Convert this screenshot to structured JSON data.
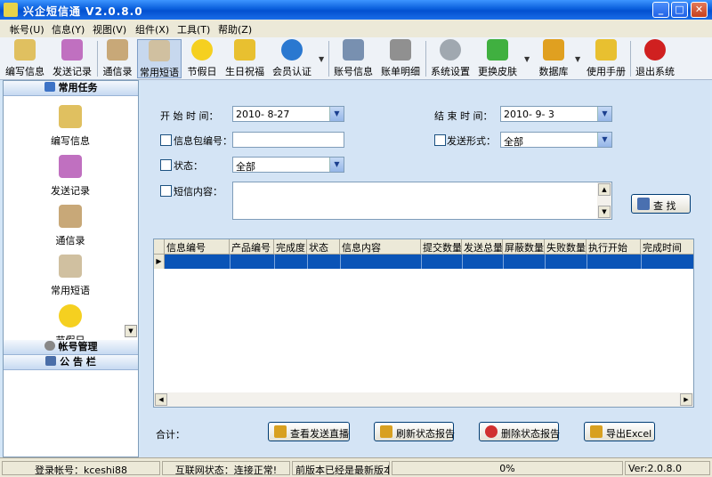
{
  "window": {
    "title": "兴企短信通 V2.0.8.0"
  },
  "menu": [
    "帐号(U)",
    "信息(Y)",
    "视图(V)",
    "组件(X)",
    "工具(T)",
    "帮助(Z)"
  ],
  "toolbar": {
    "items": [
      {
        "label": "编写信息",
        "color": "#e0c060"
      },
      {
        "label": "发送记录",
        "color": "#c070c0"
      },
      {
        "label": "通信录",
        "color": "#c8a878"
      },
      {
        "label": "常用短语",
        "color": "#d0c0a0"
      },
      {
        "label": "节假日",
        "color": "#f5d020"
      },
      {
        "label": "生日祝福",
        "color": "#e8c030"
      },
      {
        "label": "会员认证",
        "color": "#2a78d0"
      },
      {
        "label": "账号信息",
        "color": "#7890b0"
      },
      {
        "label": "账单明细",
        "color": "#909090"
      },
      {
        "label": "系统设置",
        "color": "#a0a8b0"
      },
      {
        "label": "更换皮肤",
        "color": "#40b040"
      },
      {
        "label": "数据库",
        "color": "#e0a020"
      },
      {
        "label": "使用手册",
        "color": "#e8c030"
      },
      {
        "label": "退出系统",
        "color": "#d02020"
      }
    ]
  },
  "sidebar": {
    "section_common": "常用任务",
    "items": [
      {
        "label": "编写信息",
        "color": "#e0c060"
      },
      {
        "label": "发送记录",
        "color": "#c070c0"
      },
      {
        "label": "通信录",
        "color": "#c8a878"
      },
      {
        "label": "常用短语",
        "color": "#d0c0a0"
      },
      {
        "label": "节假日",
        "color": "#f5d020"
      }
    ],
    "section_account": "帐号管理",
    "section_notice": "公 告 栏"
  },
  "form": {
    "start_label": "开 始 时 间：",
    "start_value": "2010- 8-27",
    "end_label": "结 束 时 间：",
    "end_value": "2010- 9- 3",
    "package_label": "信息包编号：",
    "package_value": "",
    "send_mode_label": "发送形式：",
    "send_mode_value": "全部",
    "status_label": "状态：",
    "status_value": "全部",
    "content_label": "短信内容：",
    "content_value": "",
    "search_label": "查 找"
  },
  "grid": {
    "columns": [
      "信息编号",
      "产品编号",
      "完成度",
      "状态",
      "信息内容",
      "提交数量",
      "发送总量",
      "屏蔽数量",
      "失败数量",
      "执行开始",
      "完成时间"
    ]
  },
  "footer": {
    "total_label": "合计：",
    "btn_view": "查看发送直播",
    "btn_refresh": "刷新状态报告",
    "btn_delete": "删除状态报告",
    "btn_export": "导出Excel"
  },
  "statusbar": {
    "login": "登录帐号：kceshi88",
    "network": "互联网状态：连接正常!",
    "version_msg": "前版本已经是最新版本",
    "progress": "0%",
    "version": "Ver:2.0.8.0"
  }
}
